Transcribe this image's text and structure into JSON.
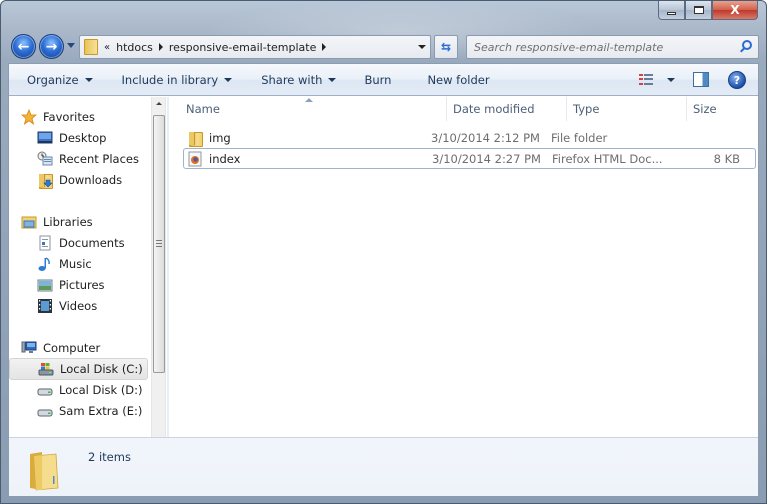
{
  "window": {
    "caption_buttons": {
      "minimize": "minimize",
      "maximize": "maximize",
      "close": "X"
    }
  },
  "navigation": {
    "back_icon": "back-arrow-icon",
    "forward_icon": "forward-arrow-icon",
    "address": {
      "overflow_glyph": "«",
      "crumbs": [
        "htdocs",
        "responsive-email-template"
      ]
    },
    "refresh_glyph": "⇆",
    "search": {
      "placeholder": "Search responsive-email-template"
    }
  },
  "toolbar": {
    "organize": "Organize",
    "include_in_library": "Include in library",
    "share_with": "Share with",
    "burn": "Burn",
    "new_folder": "New folder",
    "help_glyph": "?"
  },
  "sidebar": {
    "favorites": {
      "label": "Favorites",
      "items": [
        {
          "label": "Desktop",
          "icon": "desktop-icon"
        },
        {
          "label": "Recent Places",
          "icon": "recent-places-icon"
        },
        {
          "label": "Downloads",
          "icon": "downloads-icon"
        }
      ]
    },
    "libraries": {
      "label": "Libraries",
      "items": [
        {
          "label": "Documents",
          "icon": "documents-icon"
        },
        {
          "label": "Music",
          "icon": "music-icon"
        },
        {
          "label": "Pictures",
          "icon": "pictures-icon"
        },
        {
          "label": "Videos",
          "icon": "videos-icon"
        }
      ]
    },
    "computer": {
      "label": "Computer",
      "items": [
        {
          "label": "Local Disk (C:)",
          "icon": "system-drive-icon",
          "selected": true
        },
        {
          "label": "Local Disk (D:)",
          "icon": "drive-icon"
        },
        {
          "label": "Sam Extra (E:)",
          "icon": "drive-icon"
        }
      ]
    }
  },
  "file_list": {
    "columns": [
      "Name",
      "Date modified",
      "Type",
      "Size"
    ],
    "sort_column": "Name",
    "rows": [
      {
        "name": "img",
        "date": "3/10/2014 2:12 PM",
        "type": "File folder",
        "size": "",
        "icon": "folder-icon"
      },
      {
        "name": "index",
        "date": "3/10/2014 2:27 PM",
        "type": "Firefox HTML Doc...",
        "size": "8 KB",
        "icon": "firefox-html-icon",
        "focused": true
      }
    ]
  },
  "details_pane": {
    "item_count": "2 items"
  }
}
